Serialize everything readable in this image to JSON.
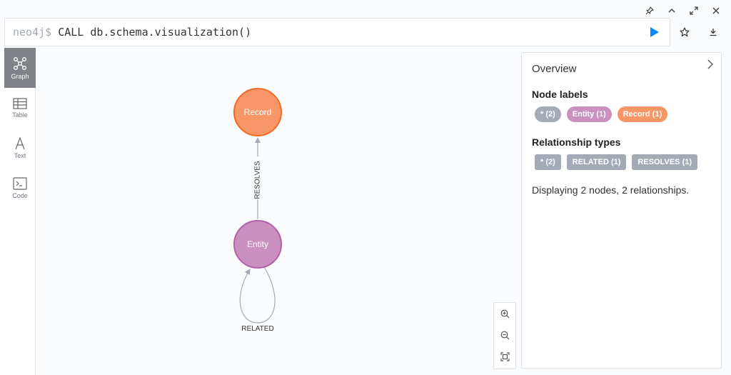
{
  "window": {
    "controls": [
      {
        "name": "pin-icon"
      },
      {
        "name": "chevron-up-icon"
      },
      {
        "name": "fullscreen-icon"
      },
      {
        "name": "close-icon"
      }
    ]
  },
  "editor": {
    "prompt": "neo4j$",
    "query": "CALL db.schema.visualization()"
  },
  "sidebar": {
    "tabs": [
      {
        "label": "Graph",
        "icon": "graph-icon",
        "active": true
      },
      {
        "label": "Table",
        "icon": "table-icon",
        "active": false
      },
      {
        "label": "Text",
        "icon": "text-icon",
        "active": false
      },
      {
        "label": "Code",
        "icon": "code-icon",
        "active": false
      }
    ]
  },
  "graph": {
    "nodes": [
      {
        "id": "record",
        "label": "Record",
        "color": "#f79767",
        "stroke": "#f36924"
      },
      {
        "id": "entity",
        "label": "Entity",
        "color": "#c990c0",
        "stroke": "#b261a5"
      }
    ],
    "relationships": [
      {
        "type": "RESOLVES",
        "from": "entity",
        "to": "record"
      },
      {
        "type": "RELATED",
        "from": "entity",
        "to": "entity"
      }
    ]
  },
  "overview": {
    "title": "Overview",
    "node_labels_heading": "Node labels",
    "node_labels": [
      {
        "text": "* (2)",
        "color": "#a5abb6"
      },
      {
        "text": "Entity (1)",
        "color": "#c990c0"
      },
      {
        "text": "Record (1)",
        "color": "#f79767"
      }
    ],
    "relationship_types_heading": "Relationship types",
    "relationship_types": [
      {
        "text": "* (2)",
        "color": "#a5abb6"
      },
      {
        "text": "RELATED (1)",
        "color": "#a5abb6"
      },
      {
        "text": "RESOLVES (1)",
        "color": "#a5abb6"
      }
    ],
    "summary": "Displaying 2 nodes, 2 relationships."
  }
}
